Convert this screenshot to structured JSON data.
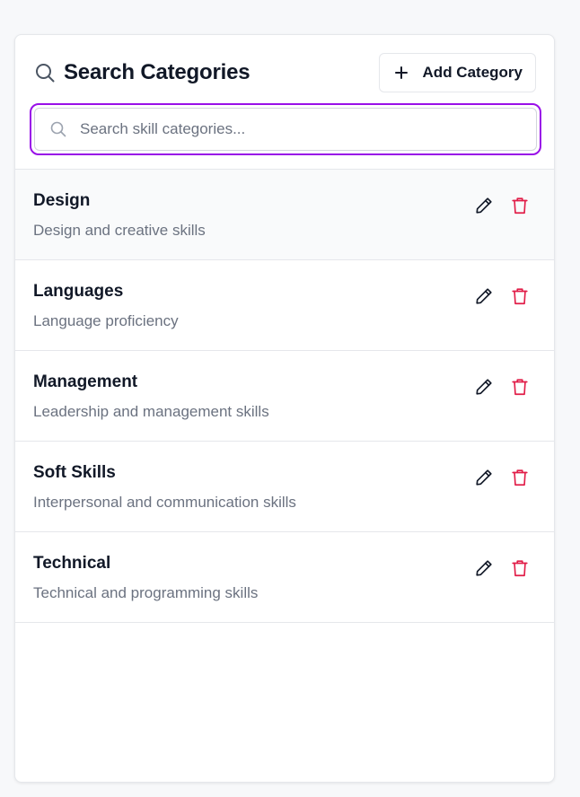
{
  "header": {
    "title": "Search Categories",
    "add_button_label": "Add Category"
  },
  "search": {
    "placeholder": "Search skill categories...",
    "value": ""
  },
  "colors": {
    "focus_ring": "#9910e8",
    "delete": "#e11d48",
    "text_primary": "#111827",
    "text_secondary": "#6b7280"
  },
  "categories": [
    {
      "name": "Design",
      "description": "Design and creative skills"
    },
    {
      "name": "Languages",
      "description": "Language proficiency"
    },
    {
      "name": "Management",
      "description": "Leadership and management skills"
    },
    {
      "name": "Soft Skills",
      "description": "Interpersonal and communication skills"
    },
    {
      "name": "Technical",
      "description": "Technical and programming skills"
    }
  ],
  "icons": {
    "title": "search-icon",
    "add": "plus-icon",
    "search": "search-icon",
    "edit": "pencil-icon",
    "delete": "trash-icon"
  }
}
